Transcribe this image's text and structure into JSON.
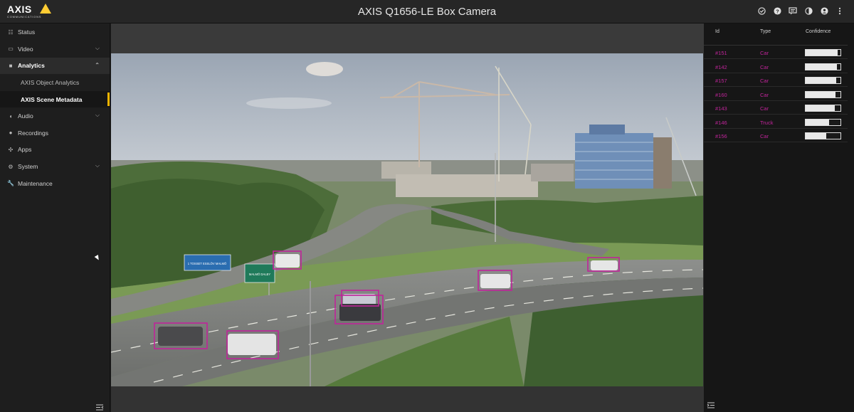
{
  "header": {
    "logo_text": "AXIS",
    "logo_subtext": "COMMUNICATIONS",
    "title": "AXIS Q1656-LE Box Camera",
    "icons": [
      "status-check-icon",
      "help-icon",
      "feedback-icon",
      "contrast-icon",
      "account-icon",
      "more-icon"
    ]
  },
  "sidebar": {
    "items": [
      {
        "label": "Status",
        "icon": "status-icon"
      },
      {
        "label": "Video",
        "icon": "video-icon",
        "expandable": true
      },
      {
        "label": "Analytics",
        "icon": "analytics-icon",
        "expanded": true
      },
      {
        "label": "AXIS Object Analytics",
        "sub": true
      },
      {
        "label": "AXIS Scene Metadata",
        "sub": true,
        "selected": true
      },
      {
        "label": "Audio",
        "icon": "audio-icon",
        "expandable": true
      },
      {
        "label": "Recordings",
        "icon": "recordings-icon"
      },
      {
        "label": "Apps",
        "icon": "apps-icon"
      },
      {
        "label": "System",
        "icon": "system-icon",
        "expandable": true
      },
      {
        "label": "Maintenance",
        "icon": "maintenance-icon"
      }
    ]
  },
  "video": {
    "signs": {
      "left_sign": "1 TOSSET  ESSLÖV  MALMÖ",
      "right_sign": "MALMÖ  DALBY"
    }
  },
  "detections_table": {
    "columns": {
      "id": "Id",
      "type": "Type",
      "confidence": "Confidence"
    },
    "rows": [
      {
        "id": "#151",
        "type": "Car",
        "confidence": 0.92
      },
      {
        "id": "#142",
        "type": "Car",
        "confidence": 0.9
      },
      {
        "id": "#157",
        "type": "Car",
        "confidence": 0.88
      },
      {
        "id": "#160",
        "type": "Car",
        "confidence": 0.86
      },
      {
        "id": "#143",
        "type": "Car",
        "confidence": 0.84
      },
      {
        "id": "#146",
        "type": "Truck",
        "confidence": 0.68
      },
      {
        "id": "#156",
        "type": "Car",
        "confidence": 0.6
      }
    ]
  },
  "colors": {
    "accent": "#f0b400",
    "detection": "#c0249a"
  }
}
